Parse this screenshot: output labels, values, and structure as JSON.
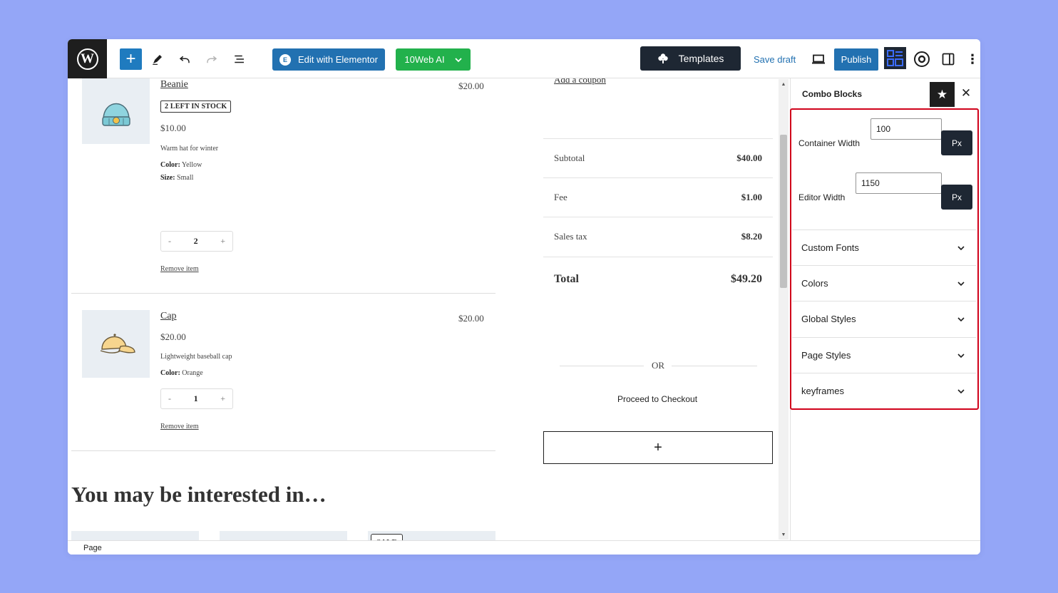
{
  "toolbar": {
    "wp_logo": "W",
    "add_label": "+",
    "elementor_label": "Edit with Elementor",
    "elementor_badge": "E",
    "ai_label": "10Web AI",
    "templates_label": "Templates",
    "save_draft": "Save draft",
    "publish": "Publish",
    "more": "⋮"
  },
  "cart": {
    "items": [
      {
        "name": "Beanie",
        "line_price": "$20.00",
        "stock_badge": "2 LEFT IN STOCK",
        "unit_price": "$10.00",
        "description": "Warm hat for winter",
        "attrs": [
          {
            "key": "Color:",
            "val": "Yellow"
          },
          {
            "key": "Size:",
            "val": "Small"
          }
        ],
        "qty": "2",
        "remove": "Remove item"
      },
      {
        "name": "Cap",
        "line_price": "$20.00",
        "unit_price": "$20.00",
        "description": "Lightweight baseball cap",
        "attrs": [
          {
            "key": "Color:",
            "val": "Orange"
          }
        ],
        "qty": "1",
        "remove": "Remove item"
      }
    ],
    "qty_minus": "-",
    "qty_plus": "+",
    "interested_heading": "You may be interested in…",
    "sale_badge": "SALE"
  },
  "totals": {
    "coupon": "Add a coupon",
    "rows": [
      {
        "label": "Subtotal",
        "amount": "$40.00"
      },
      {
        "label": "Fee",
        "amount": "$1.00"
      },
      {
        "label": "Sales tax",
        "amount": "$8.20"
      }
    ],
    "total_label": "Total",
    "total_amount": "$49.20",
    "or_text": "OR",
    "checkout": "Proceed to Checkout",
    "add_block": "+"
  },
  "sidebar": {
    "title": "Combo Blocks",
    "container_width_label": "Container Width",
    "container_width_value": "100",
    "editor_width_label": "Editor Width",
    "editor_width_value": "1150",
    "unit": "Px",
    "accordions": [
      "Custom Fonts",
      "Colors",
      "Global Styles",
      "Page Styles",
      "keyframes"
    ]
  },
  "footer": {
    "breadcrumb": "Page"
  },
  "colors": {
    "background": "#94a6f7",
    "primary_blue": "#2271b1",
    "ai_green": "#22b14c",
    "dark": "#1e2733",
    "highlight_red": "#d0021b"
  }
}
